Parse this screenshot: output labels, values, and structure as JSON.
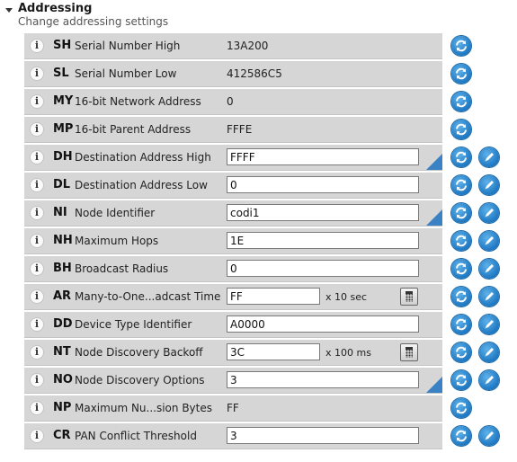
{
  "section": {
    "title": "Addressing",
    "subtitle": "Change addressing settings"
  },
  "rows": [
    {
      "code": "SH",
      "name": "Serial Number High",
      "value": "13A200",
      "kind": "readonly",
      "writable": false,
      "changed": false
    },
    {
      "code": "SL",
      "name": "Serial Number Low",
      "value": "412586C5",
      "kind": "readonly",
      "writable": false,
      "changed": false
    },
    {
      "code": "MY",
      "name": "16-bit Network Address",
      "value": "0",
      "kind": "readonly",
      "writable": false,
      "changed": false
    },
    {
      "code": "MP",
      "name": "16-bit Parent Address",
      "value": "FFFE",
      "kind": "readonly",
      "writable": false,
      "changed": false
    },
    {
      "code": "DH",
      "name": "Destination Address High",
      "value": "FFFF",
      "kind": "input",
      "writable": true,
      "changed": true
    },
    {
      "code": "DL",
      "name": "Destination Address Low",
      "value": "0",
      "kind": "input",
      "writable": true,
      "changed": false
    },
    {
      "code": "NI",
      "name": "Node Identifier",
      "value": "codi1",
      "kind": "input",
      "writable": true,
      "changed": true
    },
    {
      "code": "NH",
      "name": "Maximum Hops",
      "value": "1E",
      "kind": "input",
      "writable": true,
      "changed": false
    },
    {
      "code": "BH",
      "name": "Broadcast Radius",
      "value": "0",
      "kind": "input",
      "writable": true,
      "changed": false
    },
    {
      "code": "AR",
      "name": "Many-to-One...adcast Time",
      "value": "FF",
      "kind": "input-unit",
      "unit": "x 10 sec",
      "writable": true,
      "changed": false
    },
    {
      "code": "DD",
      "name": "Device Type Identifier",
      "value": "A0000",
      "kind": "input",
      "writable": true,
      "changed": false
    },
    {
      "code": "NT",
      "name": "Node Discovery Backoff",
      "value": "3C",
      "kind": "input-unit",
      "unit": "x 100 ms",
      "writable": true,
      "changed": false
    },
    {
      "code": "NO",
      "name": "Node Discovery Options",
      "value": "3",
      "kind": "input",
      "writable": true,
      "changed": true
    },
    {
      "code": "NP",
      "name": "Maximum Nu...sion Bytes",
      "value": "FF",
      "kind": "readonly",
      "writable": false,
      "changed": false
    },
    {
      "code": "CR",
      "name": "PAN Conflict Threshold",
      "value": "3",
      "kind": "input",
      "writable": true,
      "changed": false
    }
  ],
  "icons": {
    "info": "info-icon",
    "read": "refresh-icon",
    "write": "pencil-icon",
    "calculator": "calculator-icon"
  },
  "colors": {
    "row_bg": "#d6d6d6",
    "accent": "#1e78c2",
    "changed_marker": "#3b82c4"
  }
}
